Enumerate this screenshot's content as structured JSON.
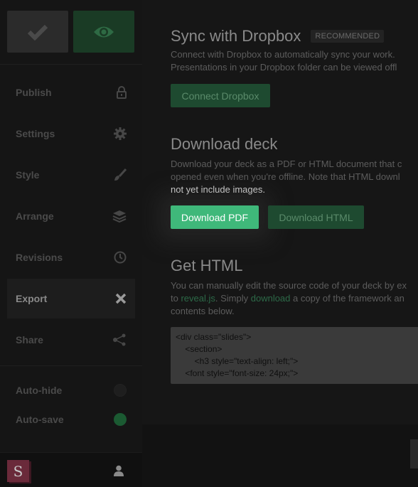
{
  "sidebar": {
    "items": [
      {
        "label": "Publish",
        "icon": "lock-icon"
      },
      {
        "label": "Settings",
        "icon": "gear-icon"
      },
      {
        "label": "Style",
        "icon": "brush-icon"
      },
      {
        "label": "Arrange",
        "icon": "layers-icon"
      },
      {
        "label": "Revisions",
        "icon": "clock-icon"
      },
      {
        "label": "Export",
        "icon": "close-icon",
        "active": true
      },
      {
        "label": "Share",
        "icon": "share-icon"
      }
    ],
    "toggles": [
      {
        "label": "Auto-hide",
        "on": false
      },
      {
        "label": "Auto-save",
        "on": true
      }
    ],
    "logo_letter": "S"
  },
  "dropbox": {
    "title": "Sync with Dropbox",
    "badge": "RECOMMENDED",
    "line1": "Connect with Dropbox to automatically sync your work.",
    "line2": "Presentations in your Dropbox folder can be viewed offl",
    "button": "Connect Dropbox"
  },
  "download": {
    "title": "Download deck",
    "line1": "Download your deck as a PDF or HTML document that c",
    "line2": "opened even when you're offline. Note that HTML downl",
    "line3": "not yet include images.",
    "pdf_button": "Download PDF",
    "html_button": "Download HTML"
  },
  "html_section": {
    "title": "Get HTML",
    "line1": "You can manually edit the source code of your deck by ex",
    "line2_prefix": "to ",
    "line2_link1": "reveal.js",
    "line2_mid": ". Simply ",
    "line2_link2": "download",
    "line2_suffix": " a copy of the framework an",
    "line3": "contents below.",
    "code": "<div class=\"slides\">\n    <section>\n        <h3 style=\"text-align: left;\">\n    <font style=\"font-size: 24px;\">\n        ..."
  },
  "colors": {
    "accent": "#3fb87a",
    "accent_dim": "#1e4a30",
    "sidebar_bg": "#151515",
    "main_bg": "#161616"
  }
}
